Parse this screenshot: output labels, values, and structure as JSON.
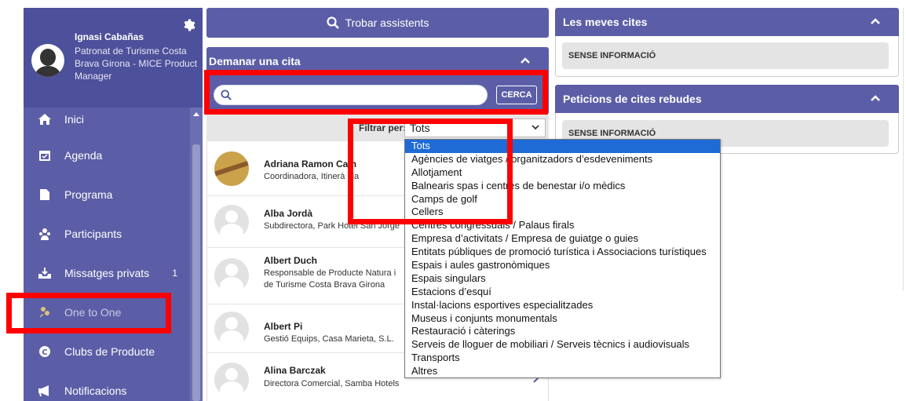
{
  "profile": {
    "name": "Ignasi Cabañas",
    "organization": "Patronat de Turisme Costa Brava Girona - MICE Product Manager"
  },
  "sidebar": {
    "items": [
      {
        "label": "Inici",
        "icon": "home-icon"
      },
      {
        "label": "Agenda",
        "icon": "calendar-icon"
      },
      {
        "label": "Programa",
        "icon": "document-icon"
      },
      {
        "label": "Participants",
        "icon": "users-icon"
      },
      {
        "label": "Missatges privats",
        "icon": "inbox-icon",
        "badge": "1"
      },
      {
        "label": "One to One",
        "icon": "one-to-one-icon"
      },
      {
        "label": "Clubs de Producte",
        "icon": "club-icon"
      },
      {
        "label": "Notificacions",
        "icon": "megaphone-icon"
      }
    ]
  },
  "middle": {
    "search_assistants_label": "Trobar assistents",
    "panel_title": "Demanar una cita",
    "search_placeholder": "",
    "search_button": "CERCA",
    "filter_label": "Filtrar per:",
    "filter_selected": "Tots",
    "people": [
      {
        "name": "Adriana Ramon Cam",
        "role": "Coordinadora, Itinerà nia"
      },
      {
        "name": "Alba Jordà",
        "role": "Subdirectora, Park Hotel San Jorge"
      },
      {
        "name": "Albert Duch",
        "role": "Responsable de Producte Natura i de Turisme Costa Brava Girona"
      },
      {
        "name": "Albert Pi",
        "role": "Gestió Equips, Casa Marieta, S.L."
      },
      {
        "name": "Alina Barczak",
        "role": "Directora Comercial, Samba Hotels"
      }
    ]
  },
  "right": {
    "my_appointments_title": "Les meves cites",
    "my_appointments_empty": "SENSE INFORMACIÓ",
    "received_requests_title": "Peticions de cites rebudes",
    "received_requests_empty": "SENSE INFORMACIÓ"
  },
  "dropdown": {
    "options": [
      "Tots",
      "Agències de viatges / organitzadors d’esdeveniments",
      "Allotjament",
      "Balnearis spas i centres de benestar i/o mèdics",
      "Camps de golf",
      "Cellers",
      "Centres congressuals / Palaus firals",
      "Empresa d’activitats / Empresa de guiatge o guies",
      "Entitats públiques de promoció turística i Associacions turístiques",
      "Espais i aules gastronòmiques",
      "Espais singulars",
      "Estacions d’esquí",
      "Instal·lacions esportives especialitzades",
      "Museus i conjunts monumentals",
      "Restauració i càterings",
      "Serveis de lloguer de mobiliari / Serveis tècnics i audiovisuals",
      "Transports",
      "Altres"
    ]
  },
  "colors": {
    "primary": "#5b5ea6",
    "annotation": "#ff0000",
    "selected": "#1e6bd6"
  }
}
